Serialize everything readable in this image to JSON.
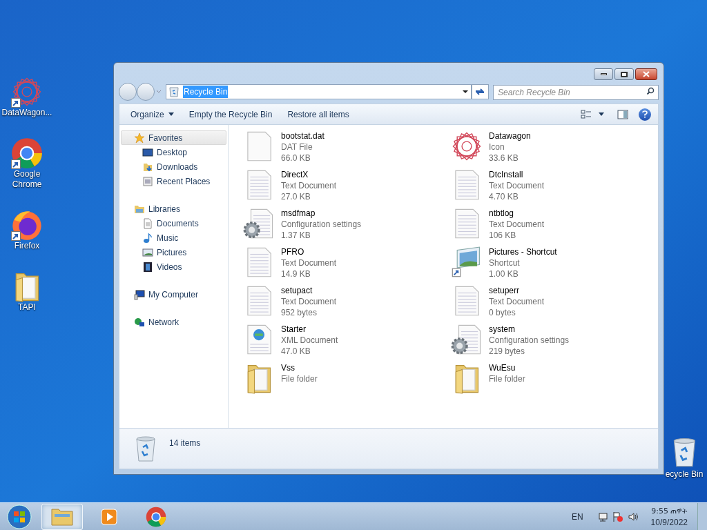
{
  "desktop_icons": [
    {
      "label": "DataWagon...",
      "kind": "star",
      "shortcut": true
    },
    {
      "label": "Google Chrome",
      "kind": "chrome",
      "shortcut": true
    },
    {
      "label": "Firefox",
      "kind": "firefox",
      "shortcut": true
    },
    {
      "label": "TAPI",
      "kind": "folder",
      "shortcut": false
    }
  ],
  "desktop_recycle_bin": {
    "label": "ecycle Bin"
  },
  "window": {
    "address": {
      "text": "Recycle Bin",
      "selected": true
    },
    "search": {
      "placeholder": "Search Recycle Bin"
    },
    "toolbar": [
      {
        "label": "Organize",
        "dropdown": true
      },
      {
        "label": "Empty the Recycle Bin",
        "dropdown": false
      },
      {
        "label": "Restore all items",
        "dropdown": false
      }
    ],
    "sidebar": [
      {
        "label": "Favorites",
        "kind": "star",
        "selected": true,
        "children": [
          {
            "label": "Desktop",
            "kind": "desktop",
            "selected": false
          },
          {
            "label": "Downloads",
            "kind": "downloads",
            "selected": false
          },
          {
            "label": "Recent Places",
            "kind": "recent",
            "selected": false
          }
        ]
      },
      {
        "label": "Libraries",
        "kind": "library",
        "selected": false,
        "children": [
          {
            "label": "Documents",
            "kind": "document",
            "selected": false
          },
          {
            "label": "Music",
            "kind": "music",
            "selected": false
          },
          {
            "label": "Pictures",
            "kind": "pictures",
            "selected": false
          },
          {
            "label": "Videos",
            "kind": "videos",
            "selected": false
          }
        ]
      },
      {
        "label": "My Computer",
        "kind": "computer",
        "selected": false
      },
      {
        "label": "Network",
        "kind": "network",
        "selected": false
      }
    ],
    "files": [
      {
        "name": "bootstat.dat",
        "type": "DAT File",
        "size": "66.0 KB",
        "kind": "blank"
      },
      {
        "name": "Datawagon",
        "type": "Icon",
        "size": "33.6 KB",
        "kind": "star"
      },
      {
        "name": "DirectX",
        "type": "Text Document",
        "size": "27.0 KB",
        "kind": "text"
      },
      {
        "name": "DtcInstall",
        "type": "Text Document",
        "size": "4.70 KB",
        "kind": "text"
      },
      {
        "name": "msdfmap",
        "type": "Configuration settings",
        "size": "1.37 KB",
        "kind": "config"
      },
      {
        "name": "ntbtlog",
        "type": "Text Document",
        "size": "106 KB",
        "kind": "text"
      },
      {
        "name": "PFRO",
        "type": "Text Document",
        "size": "14.9 KB",
        "kind": "text"
      },
      {
        "name": "Pictures - Shortcut",
        "type": "Shortcut",
        "size": "1.00 KB",
        "kind": "shortcut"
      },
      {
        "name": "setupact",
        "type": "Text Document",
        "size": "952 bytes",
        "kind": "text"
      },
      {
        "name": "setuperr",
        "type": "Text Document",
        "size": "0 bytes",
        "kind": "text"
      },
      {
        "name": "Starter",
        "type": "XML Document",
        "size": "47.0 KB",
        "kind": "xml"
      },
      {
        "name": "system",
        "type": "Configuration settings",
        "size": "219 bytes",
        "kind": "config"
      },
      {
        "name": "Vss",
        "type": "File folder",
        "kind": "folder"
      },
      {
        "name": "WuEsu",
        "type": "File folder",
        "kind": "folder"
      }
    ],
    "status_bar": {
      "count": "14 items"
    }
  },
  "taskbar": {
    "apps": [
      {
        "kind": "explorer",
        "active": true
      },
      {
        "kind": "media",
        "active": false
      },
      {
        "kind": "chrome",
        "active": false
      }
    ],
    "language": "EN",
    "time": "9:55 ጠዋት",
    "date": "10/9/2022"
  }
}
